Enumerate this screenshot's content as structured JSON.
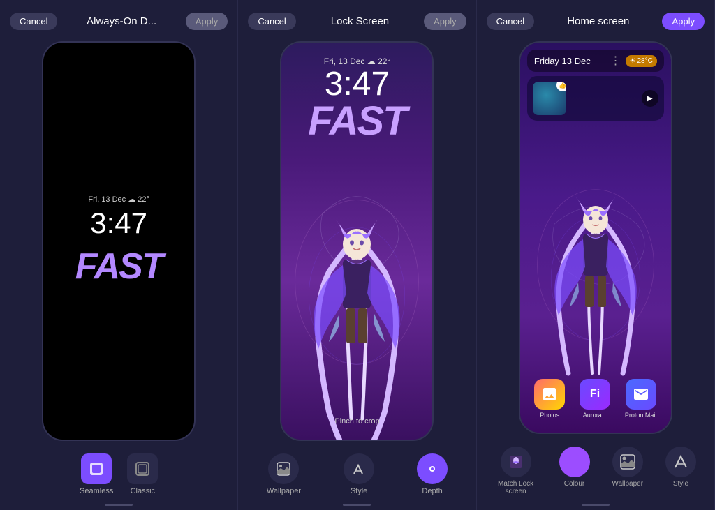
{
  "panels": [
    {
      "id": "aod",
      "title": "Always-On D...",
      "cancel_label": "Cancel",
      "apply_label": "Apply",
      "apply_active": false,
      "screen": {
        "date": "Fri, 13 Dec ☁ 22°",
        "time": "3:47",
        "word": "FAST"
      },
      "tools": [
        {
          "label": "Seamless",
          "active": true,
          "icon": "⊞"
        },
        {
          "label": "Classic",
          "active": false,
          "icon": "▣"
        }
      ]
    },
    {
      "id": "lock",
      "title": "Lock Screen",
      "cancel_label": "Cancel",
      "apply_label": "Apply",
      "apply_active": false,
      "screen": {
        "date": "Fri, 13 Dec ☁ 22°",
        "time": "3:47",
        "word": "FAST",
        "pinch_label": "Pinch to crop"
      },
      "tools": [
        {
          "label": "Wallpaper",
          "active": false,
          "icon": "🖼"
        },
        {
          "label": "Style",
          "active": false,
          "icon": "✂"
        },
        {
          "label": "Depth",
          "active": true,
          "icon": "◉"
        }
      ]
    },
    {
      "id": "home",
      "title": "Home screen",
      "cancel_label": "Cancel",
      "apply_label": "Apply",
      "apply_active": true,
      "screen": {
        "date": "Friday 13 Dec",
        "weather": "28°C",
        "apps": [
          {
            "label": "Photos",
            "icon": "📷"
          },
          {
            "label": "Aurora...",
            "icon": "✦"
          },
          {
            "label": "Proton Mail",
            "icon": "✉"
          }
        ]
      },
      "tools": [
        {
          "label": "Match Lock\nscreen",
          "active": false,
          "icon": "char"
        },
        {
          "label": "Colour",
          "active": true,
          "icon": "circle"
        },
        {
          "label": "Wallpaper",
          "active": false,
          "icon": "🖼"
        },
        {
          "label": "Style",
          "active": false,
          "icon": "✂"
        }
      ]
    }
  ]
}
